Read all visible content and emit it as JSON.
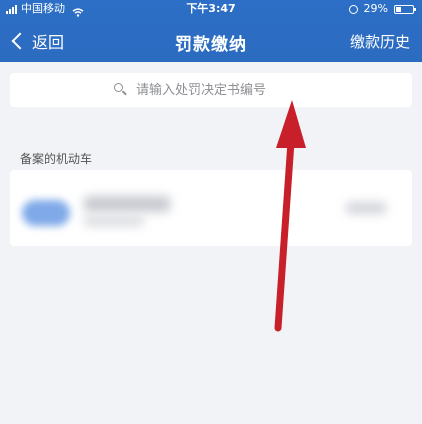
{
  "status_bar": {
    "carrier": "中国移动",
    "time": "下午3:47",
    "battery_percent": "29%",
    "battery_level": 0.29
  },
  "nav": {
    "back_label": "返回",
    "title": "罚款缴纳",
    "history_label": "缴款历史"
  },
  "search": {
    "placeholder": "请输入处罚决定书编号"
  },
  "section": {
    "label": "备案的机动车"
  },
  "colors": {
    "header": "#2b6bc0",
    "background": "#f2f3f7",
    "annotation_arrow": "#d4242a"
  },
  "icons": [
    "signal-icon",
    "wifi-icon",
    "alarm-icon",
    "battery-icon",
    "chevron-left-icon",
    "search-icon",
    "arrow-annotation"
  ]
}
